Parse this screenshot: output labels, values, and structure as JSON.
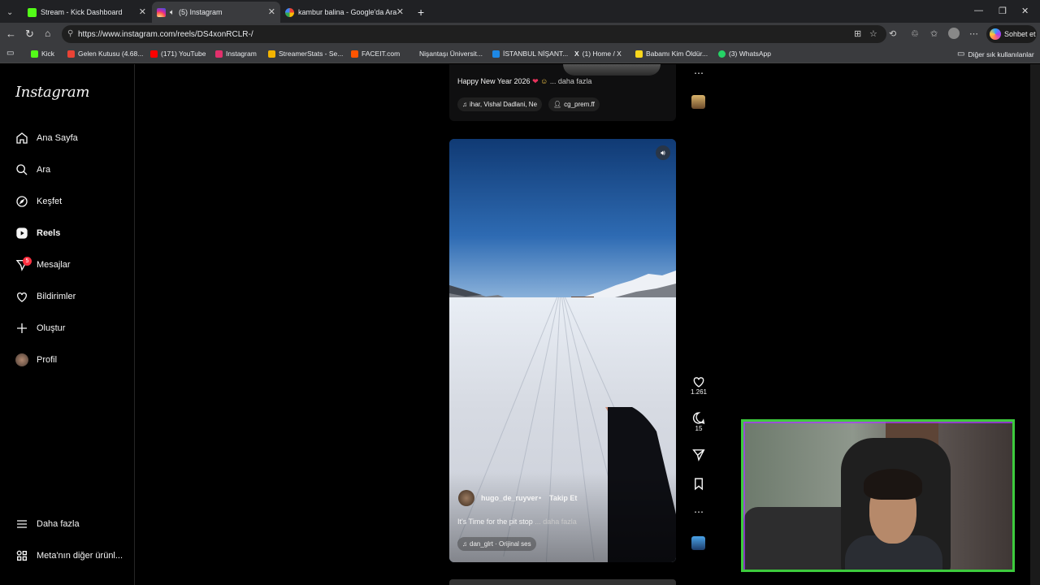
{
  "browser": {
    "tabs": [
      {
        "title": "Stream - Kick Dashboard",
        "favicon_color": "#53fc18",
        "active": false
      },
      {
        "title": "(5) Instagram",
        "favicon_color": "#e1306c",
        "active": true
      },
      {
        "title": "kambur balina - Google'da Ara",
        "favicon_color": "#ffffff",
        "active": false
      }
    ],
    "url": "https://www.instagram.com/reels/DS4xonRCLR-/",
    "copilot_label": "Sohbet et",
    "bookmarks": [
      {
        "label": "Kick",
        "color": "#53fc18"
      },
      {
        "label": "Gelen Kutusu (4.68...",
        "color": "#ea4335"
      },
      {
        "label": "(171) YouTube",
        "color": "#ff0000"
      },
      {
        "label": "Instagram",
        "color": "#e1306c"
      },
      {
        "label": "StreamerStats - Se...",
        "color": "#f4b400"
      },
      {
        "label": "FACEIT.com",
        "color": "#ff5500"
      },
      {
        "label": "Nişantaşı Üniversit...",
        "color": "#3a3b3e"
      },
      {
        "label": "İSTANBUL NİŞANT...",
        "color": "#1e88e5"
      },
      {
        "label": "(1) Home / X",
        "color": "#000000"
      },
      {
        "label": "Babamı Kim Öldür...",
        "color": "#f9d71c"
      },
      {
        "label": "(3) WhatsApp",
        "color": "#25d366"
      }
    ],
    "other_bookmarks": "Diğer sık kullanılanlar"
  },
  "instagram": {
    "logo": "Instagram",
    "nav": [
      {
        "label": "Ana Sayfa",
        "icon": "home-icon"
      },
      {
        "label": "Ara",
        "icon": "search-icon"
      },
      {
        "label": "Keşfet",
        "icon": "explore-icon"
      },
      {
        "label": "Reels",
        "icon": "reels-icon",
        "active": true
      },
      {
        "label": "Mesajlar",
        "icon": "messages-icon",
        "badge": "5"
      },
      {
        "label": "Bildirimler",
        "icon": "heart-icon"
      },
      {
        "label": "Oluştur",
        "icon": "plus-icon"
      },
      {
        "label": "Profil",
        "icon": "avatar"
      }
    ],
    "more": "Daha fazla",
    "meta": "Meta'nın diğer ürünl..."
  },
  "previous_reel": {
    "caption": "Happy New Year 2026",
    "more": "... daha fazla",
    "audio": "ihar, Vishal Dadlani, Ne",
    "user_tag": "cg_prem.ff"
  },
  "reel": {
    "username": "hugo_de_ruyver",
    "separator": "•",
    "follow": "Takip Et",
    "caption": "It's Time for the pit stop",
    "more": "... daha fazla",
    "audio": "dan_glrt · Orijinal ses",
    "likes": "1.261",
    "comments": "15"
  },
  "colors": {
    "accent_webcam_border": "#3dcb3d",
    "badge": "#ff3040",
    "follow": "#ffffff"
  }
}
